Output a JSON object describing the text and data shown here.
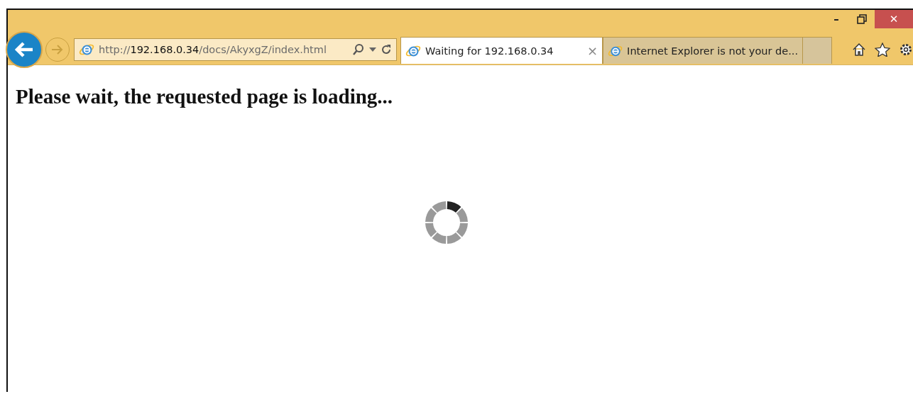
{
  "address_bar": {
    "url": "http://**192.168.0.34**/docs/AkyxgZ/index.html"
  },
  "tabs": [
    {
      "title": "Waiting for 192.168.0.34",
      "selected": true,
      "close": "×"
    },
    {
      "title": "Internet Explorer is not your de...",
      "selected": false
    }
  ],
  "window_controls": {
    "minimize": "–",
    "close": "✕"
  },
  "page": {
    "heading": "Please wait, the requested page is loading..."
  }
}
